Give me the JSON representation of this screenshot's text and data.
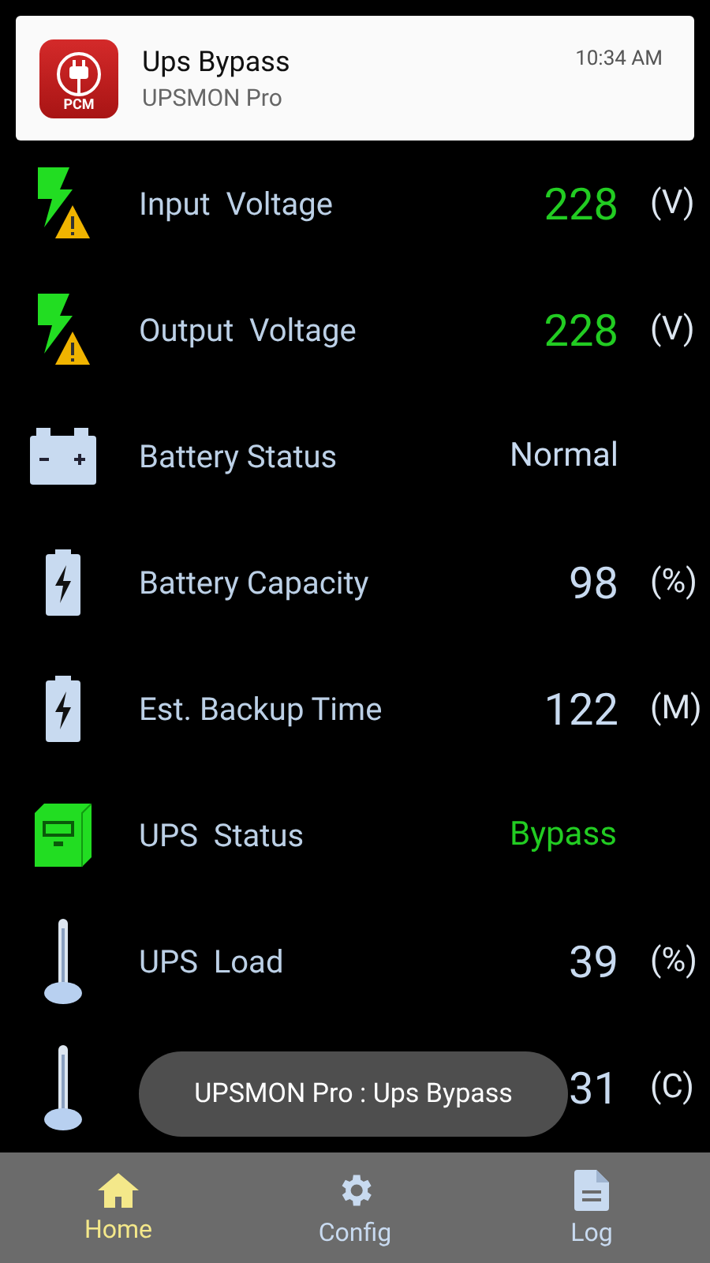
{
  "notification": {
    "title": "Ups Bypass",
    "app": "UPSMON Pro",
    "time": "10:34 AM",
    "badge": "PCM"
  },
  "rows": [
    {
      "kind": "voltage",
      "label": "Input  Voltage",
      "value": "228",
      "unit": "(V)",
      "highlighted": true
    },
    {
      "kind": "voltage",
      "label": "Output  Voltage",
      "value": "228",
      "unit": "(V)",
      "highlighted": true
    },
    {
      "kind": "battery-status",
      "label": "Battery Status",
      "value": "Normal",
      "highlighted": false
    },
    {
      "kind": "battery",
      "label": "Battery Capacity",
      "value": "98",
      "unit": "(%)",
      "highlighted": false
    },
    {
      "kind": "battery",
      "label": "Est. Backup Time",
      "value": "122",
      "unit": "(M)",
      "highlighted": false
    },
    {
      "kind": "ups",
      "label": "UPS  Status",
      "value": "Bypass",
      "highlighted": true
    },
    {
      "kind": "gauge",
      "label": "UPS  Load",
      "value": "39",
      "unit": "(%)",
      "highlighted": false
    },
    {
      "kind": "gauge",
      "value": "31",
      "unit": "(C)",
      "highlighted": false
    }
  ],
  "toast": "UPSMON Pro : Ups Bypass",
  "nav": [
    {
      "kind": "home",
      "label": "Home",
      "selected": true
    },
    {
      "kind": "config",
      "label": "Config",
      "selected": false
    },
    {
      "kind": "log",
      "label": "Log",
      "selected": false
    }
  ]
}
